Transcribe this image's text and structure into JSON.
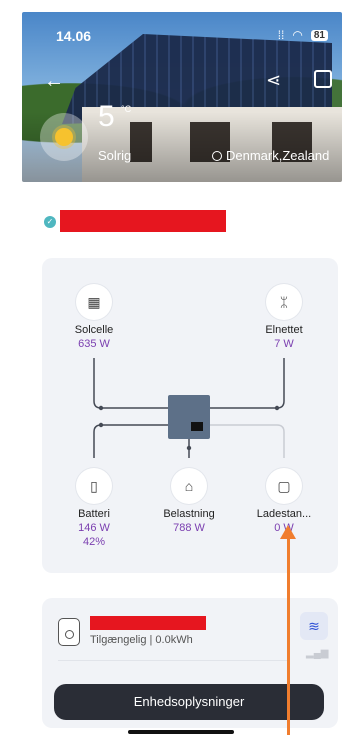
{
  "status_bar": {
    "time": "14.06",
    "battery": "81",
    "icons": [
      "signal-icon",
      "wifi-icon",
      "battery-icon"
    ]
  },
  "header": {
    "temperature": "5",
    "temperature_unit": "°C",
    "condition": "Solrig",
    "location": "Denmark,Zealand",
    "icons": [
      "back-arrow-icon",
      "share-icon",
      "scan-icon",
      "sun-icon",
      "location-pin-icon"
    ]
  },
  "flow": {
    "solar": {
      "label": "Solcelle",
      "value": "635 W"
    },
    "grid": {
      "label": "Elnettet",
      "value": "7 W"
    },
    "battery": {
      "label": "Batteri",
      "value": "146 W",
      "soc": "42%"
    },
    "load": {
      "label": "Belastning",
      "value": "788 W"
    },
    "charger": {
      "label": "Ladestan...",
      "value": "0 W"
    }
  },
  "device": {
    "status": "Tilgængelig | 0.0kWh"
  },
  "action": {
    "label": "Enhedsoplysninger"
  },
  "colors": {
    "accent_purple": "#7b3fb0",
    "redaction": "#e6161f",
    "annotation_arrow": "#f07d2e",
    "check_teal": "#4fb7c0"
  }
}
